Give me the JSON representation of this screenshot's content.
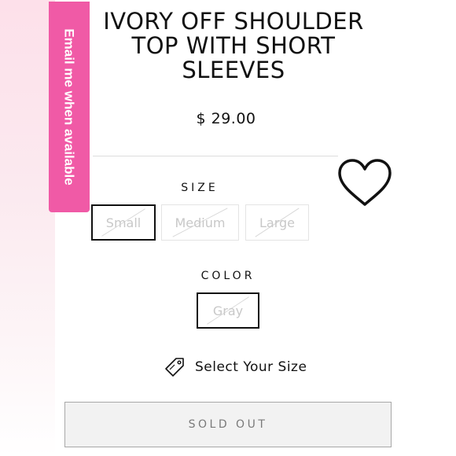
{
  "product": {
    "title": "IVORY OFF SHOULDER TOP WITH SHORT SLEEVES",
    "price": "$ 29.00"
  },
  "email_tab": {
    "label": "Email me when available"
  },
  "size": {
    "label": "SIZE",
    "options": [
      "Small",
      "Medium",
      "Large"
    ],
    "selected": "Small"
  },
  "color": {
    "label": "COLOR",
    "options": [
      "Gray"
    ],
    "selected": "Gray"
  },
  "select_size": {
    "label": "Select Your Size",
    "icon": "tag-icon"
  },
  "sold_out": {
    "label": "SOLD OUT"
  },
  "wishlist": {
    "icon": "heart-icon"
  }
}
